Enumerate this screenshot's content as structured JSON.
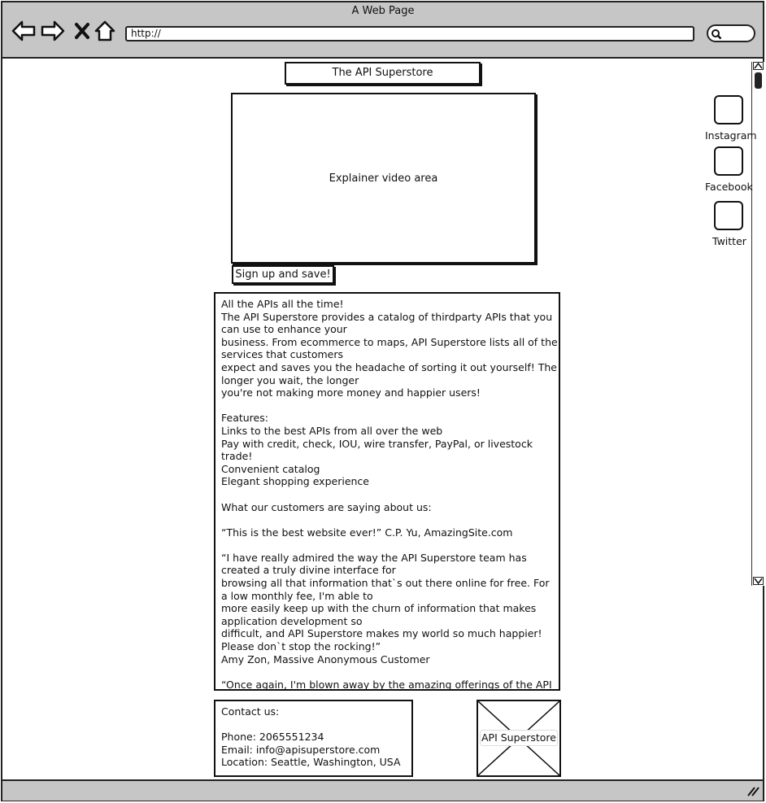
{
  "browser": {
    "window_title": "A Web Page",
    "url": "http://",
    "nav_icons": [
      "back-arrow-icon",
      "forward-arrow-icon",
      "close-x-icon",
      "home-icon"
    ],
    "search_icon": "search-icon"
  },
  "page": {
    "site_title": "The API Superstore",
    "video_label": "Explainer video area",
    "signup_label": "Sign up and save!",
    "body_text": "All the APIs all the time!\nThe API Superstore provides a catalog of thirdparty APIs that you can use to enhance your\nbusiness. From ecommerce to maps, API Superstore lists all of the services that customers\nexpect and saves you the headache of sorting it out yourself! The longer you wait, the longer\nyou're not making more money and happier users!\n\nFeatures:\nLinks to the best APIs from all over the web\nPay with credit, check, IOU, wire transfer, PayPal, or livestock trade!\nConvenient catalog\nElegant shopping experience\n\nWhat our customers are saying about us:\n\n“This is the best website ever!”  C.P. Yu, AmazingSite.com\n\n“I have really admired the way the API Superstore team has created a truly divine interface for\nbrowsing all that information that`s out there online for free. For a low monthly fee, I'm able to\nmore easily keep up with the churn of information that makes application development so\ndifficult, and API Superstore makes my world so much happier! Please don`t stop the rocking!”\n Amy Zon, Massive Anonymous Customer\n\n“Once again, I'm blown away by the amazing offerings of the API Superstore. You really are SUPER!”  Clara Cache",
    "contact_text": "Contact us:\n\nPhone: 2065551234\nEmail: info@apisuperstore.com\nLocation: Seattle, Washington, USA",
    "image_label": "API Superstore"
  },
  "social": [
    {
      "label": "Instagram",
      "icon": "instagram-icon"
    },
    {
      "label": "Facebook",
      "icon": "facebook-icon"
    },
    {
      "label": "Twitter",
      "icon": "twitter-icon"
    }
  ]
}
